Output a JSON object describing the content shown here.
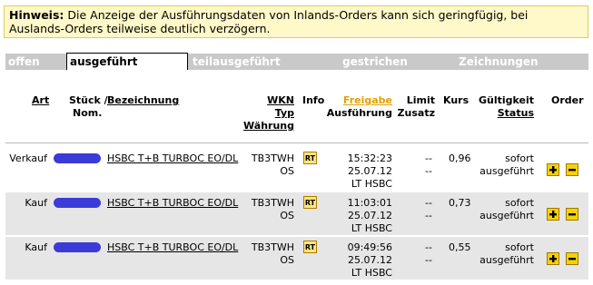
{
  "notice": {
    "label": "Hinweis:",
    "text_line1": "Die Anzeige der Ausführungsdaten von Inlands-Orders kann sich geringfügig, bei",
    "text_line2": "Auslands-Orders teilweise deutlich verzögern."
  },
  "tabs": [
    {
      "label": "offen"
    },
    {
      "label": "ausgeführt"
    },
    {
      "label": "teilausgeführt"
    },
    {
      "label": "gestrichen"
    },
    {
      "label": "Zeichnungen"
    }
  ],
  "columns": {
    "art": "Art",
    "stueck": "Stück /",
    "nom": "Nom.",
    "bezeichnung": "Bezeichnung",
    "wkn": "WKN",
    "typ": "Typ",
    "waehrung": "Währung",
    "info": "Info",
    "freigabe": "Freigabe",
    "ausfuehrung": "Ausführung",
    "limit": "Limit",
    "zusatz": "Zusatz",
    "kurs": "Kurs",
    "gueltigkeit": "Gültigkeit",
    "status": "Status",
    "order": "Order"
  },
  "rows": [
    {
      "art": "Verkauf",
      "bezeichnung": "HSBC T+B TURBOC EO/DL",
      "wkn": "TB3TWH",
      "typ": "OS",
      "info": "RT",
      "time": "15:32:23",
      "date": "25.07.12",
      "venue": "LT HSBC",
      "limit": "--",
      "zusatz": "--",
      "kurs": "0,96",
      "gueltigkeit": "sofort",
      "status": "ausgeführt"
    },
    {
      "art": "Kauf",
      "bezeichnung": "HSBC T+B TURBOC EO/DL",
      "wkn": "TB3TWH",
      "typ": "OS",
      "info": "RT",
      "time": "11:03:01",
      "date": "25.07.12",
      "venue": "LT HSBC",
      "limit": "--",
      "zusatz": "--",
      "kurs": "0,73",
      "gueltigkeit": "sofort",
      "status": "ausgeführt"
    },
    {
      "art": "Kauf",
      "bezeichnung": "HSBC T+B TURBOC EO/DL",
      "wkn": "TB3TWH",
      "typ": "OS",
      "info": "RT",
      "time": "09:49:56",
      "date": "25.07.12",
      "venue": "LT HSBC",
      "limit": "--",
      "zusatz": "--",
      "kurs": "0,55",
      "gueltigkeit": "sofort",
      "status": "ausgeführt"
    }
  ],
  "colors": {
    "notice_bg": "#fff8c8",
    "tab_bar": "#c9c9c9",
    "row_bg": "#e6e6e6",
    "accent_orange": "#e4a000",
    "button_yellow": "#f7d200",
    "redaction_blue": "#3b3bd8"
  }
}
